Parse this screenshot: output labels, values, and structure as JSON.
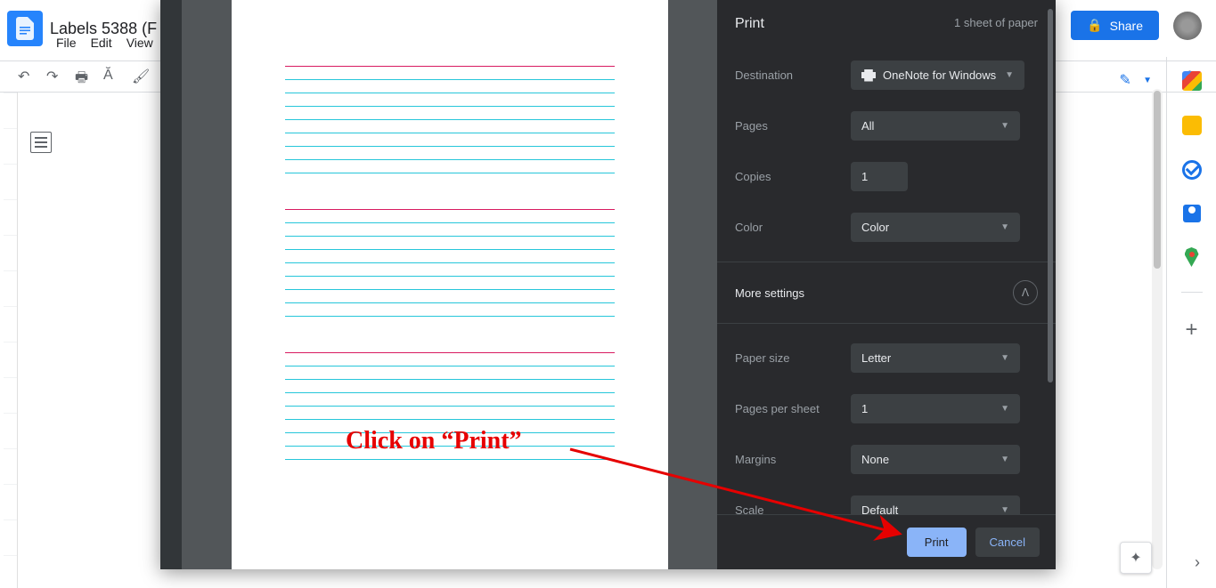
{
  "docs": {
    "title": "Labels 5388 (F",
    "menus": {
      "file": "File",
      "edit": "Edit",
      "view": "View"
    },
    "share_label": "Share"
  },
  "print": {
    "header_title": "Print",
    "sheet_count": "1 sheet of paper",
    "labels": {
      "destination": "Destination",
      "pages": "Pages",
      "copies": "Copies",
      "color": "Color",
      "more_settings": "More settings",
      "paper_size": "Paper size",
      "pages_per_sheet": "Pages per sheet",
      "margins": "Margins",
      "scale": "Scale"
    },
    "values": {
      "destination": "OneNote for Windows",
      "pages": "All",
      "copies": "1",
      "color": "Color",
      "paper_size": "Letter",
      "pages_per_sheet": "1",
      "margins": "None",
      "scale": "Default"
    },
    "buttons": {
      "print": "Print",
      "cancel": "Cancel"
    }
  },
  "annotation": {
    "text": "Click on “Print”"
  }
}
